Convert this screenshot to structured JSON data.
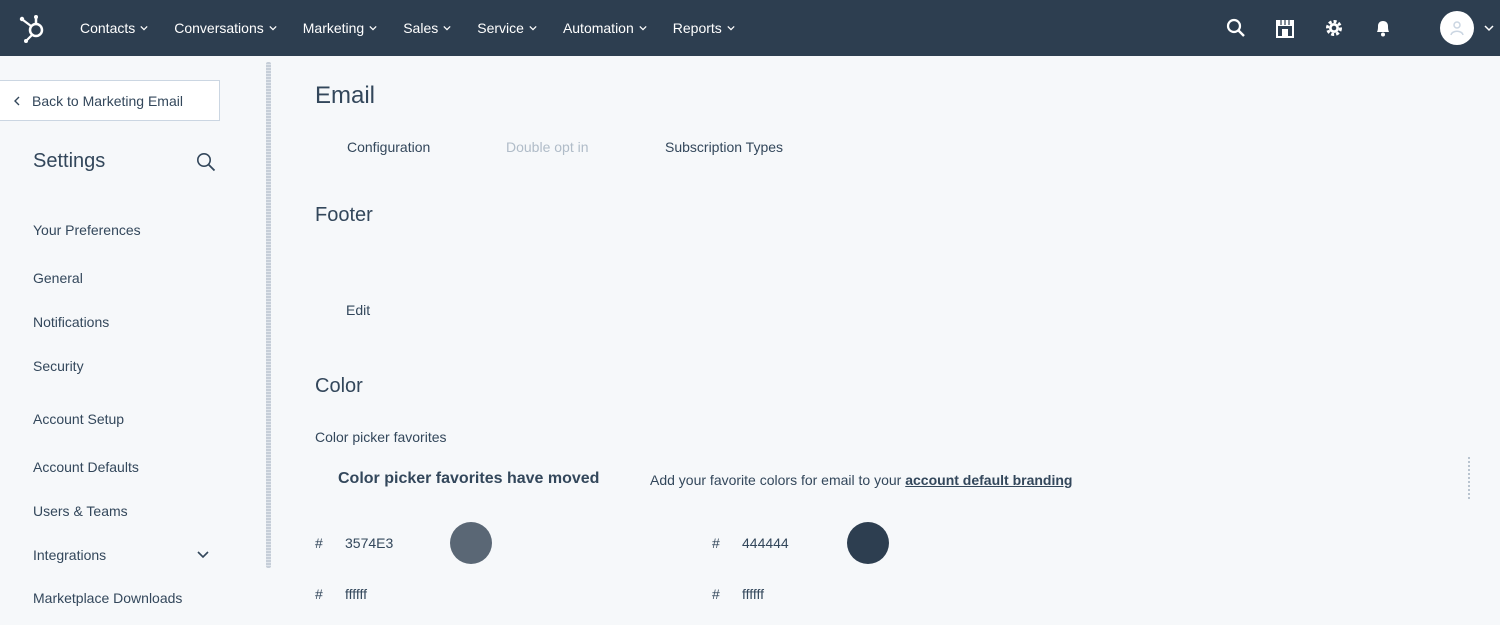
{
  "nav": {
    "items": [
      {
        "label": "Contacts"
      },
      {
        "label": "Conversations"
      },
      {
        "label": "Marketing"
      },
      {
        "label": "Sales"
      },
      {
        "label": "Service"
      },
      {
        "label": "Automation"
      },
      {
        "label": "Reports"
      }
    ],
    "icons": [
      "search-icon",
      "marketplace-icon",
      "gear-icon",
      "bell-icon"
    ],
    "bg_color": "#2d3e50"
  },
  "sidebar": {
    "back_label": "Back to Marketing Email",
    "title": "Settings",
    "sections": [
      {
        "heading": "Your Preferences",
        "items": [
          "General",
          "Notifications",
          "Security"
        ]
      },
      {
        "heading": "Account Setup",
        "items": [
          "Account Defaults",
          "Users & Teams",
          "Integrations",
          "Marketplace Downloads"
        ]
      }
    ]
  },
  "main": {
    "title": "Email",
    "tabs": [
      {
        "label": "Configuration",
        "state": "active"
      },
      {
        "label": "Double opt in",
        "state": "disabled"
      },
      {
        "label": "Subscription Types",
        "state": "normal"
      }
    ],
    "footer": {
      "heading": "Footer",
      "edit_label": "Edit"
    },
    "color": {
      "heading": "Color",
      "favorites_label": "Color picker favorites",
      "moved_title": "Color picker favorites have moved",
      "moved_text": "Add your favorite colors for email to your",
      "moved_link": "account default branding",
      "entries": [
        {
          "hash": "#",
          "hex": "3574E3",
          "swatch": "#5a6775"
        },
        {
          "hash": "#",
          "hex": "444444",
          "swatch": "#2d3e50"
        },
        {
          "hash": "#",
          "hex": "ffffff",
          "swatch": ""
        },
        {
          "hash": "#",
          "hex": "ffffff",
          "swatch": ""
        }
      ]
    }
  }
}
